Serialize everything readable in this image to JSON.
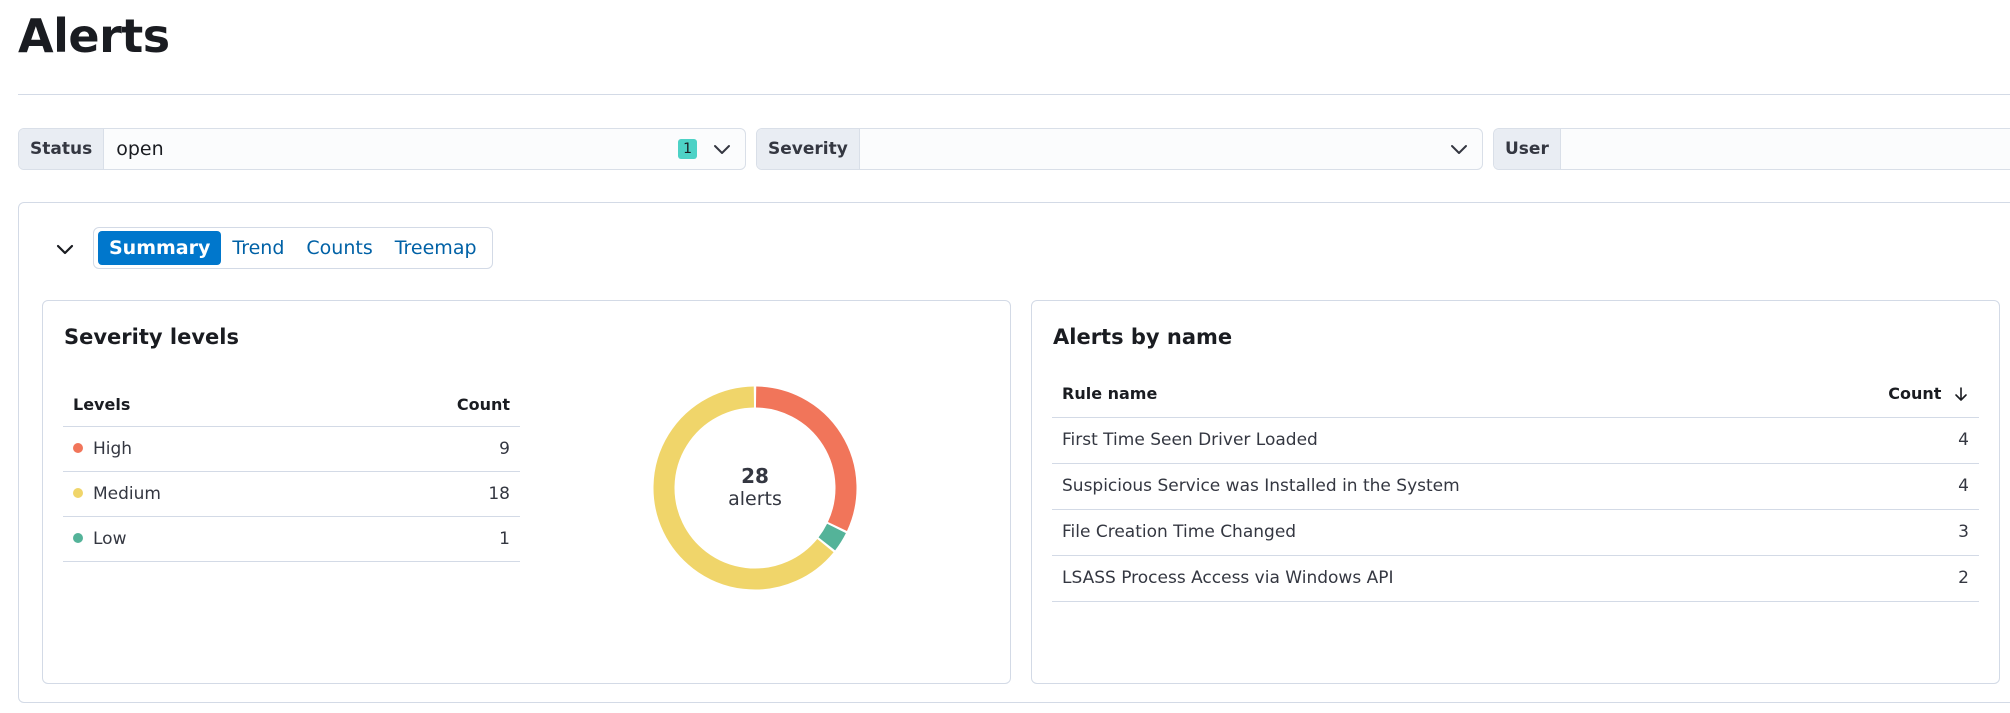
{
  "page": {
    "title": "Alerts"
  },
  "filters": [
    {
      "label": "Status",
      "value": "open",
      "badge": "1"
    },
    {
      "label": "Severity",
      "value": ""
    },
    {
      "label": "User",
      "value": ""
    }
  ],
  "tabs": [
    {
      "label": "Summary",
      "active": true
    },
    {
      "label": "Trend"
    },
    {
      "label": "Counts"
    },
    {
      "label": "Treemap"
    }
  ],
  "severity": {
    "title": "Severity levels",
    "columns": [
      "Levels",
      "Count"
    ],
    "rows": [
      {
        "level": "High",
        "count": "9",
        "color": "#f1755a"
      },
      {
        "level": "Medium",
        "count": "18",
        "color": "#f0d56a"
      },
      {
        "level": "Low",
        "count": "1",
        "color": "#54b399"
      }
    ],
    "donut": {
      "total": "28",
      "unit": "alerts"
    }
  },
  "alerts_by_name": {
    "title": "Alerts by name",
    "columns": [
      "Rule name",
      "Count"
    ],
    "sort_icon": "arrow-down-icon",
    "rows": [
      {
        "name": "First Time Seen Driver Loaded",
        "count": "4"
      },
      {
        "name": "Suspicious Service was Installed in the System",
        "count": "4"
      },
      {
        "name": "File Creation Time Changed",
        "count": "3"
      },
      {
        "name": "LSASS Process Access via Windows API",
        "count": "2"
      }
    ]
  },
  "icons": {
    "filter_dropdown": "chevron-down-icon",
    "collapse": "chevron-down-icon"
  }
}
